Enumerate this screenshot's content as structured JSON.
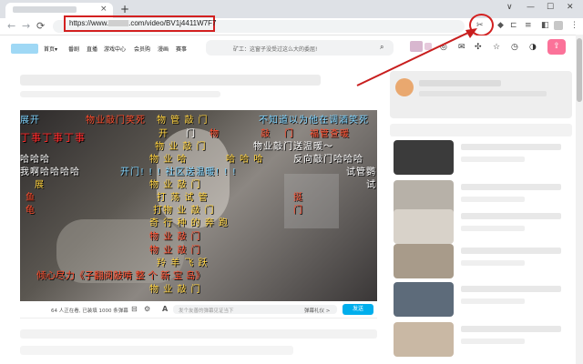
{
  "browser": {
    "newtab_icon": "+",
    "close_icon": "×",
    "window_controls": [
      "∨",
      "—",
      "☐",
      "✕"
    ],
    "nav_icons": [
      "←",
      "→",
      "⟳"
    ],
    "url_prefix": "https://www.",
    "url_suffix": ".com/video/BV1j4411W7F7"
  },
  "site": {
    "nav_items": [
      "首页",
      "番剧",
      "直播",
      "游戏中心",
      "会员购",
      "漫画",
      "赛事"
    ],
    "nav_chevron": "▾",
    "search_placeholder": "矿工：这窗子没受过这么大的委屈!",
    "search_icon": "⌕",
    "header_icons": [
      "◎",
      "✉",
      "☆",
      "◷",
      "◑"
    ],
    "upload_icon": "⇪"
  },
  "player": {
    "danmaku": [
      {
        "text": "展开",
        "color": "#7fd4ff"
      },
      {
        "text": "物业敲门笑死",
        "color": "#ff4b2b"
      },
      {
        "text": "物 管 敲 门",
        "color": "#ffd23f"
      },
      {
        "text": "不知道以为他在调酒笑死",
        "color": "#7fd4ff"
      },
      {
        "text": "开",
        "color": "#ffd23f"
      },
      {
        "text": "丁事丁事丁事",
        "color": "#ff2a2a"
      },
      {
        "text": "门",
        "color": "#ffffff"
      },
      {
        "text": "物",
        "color": "#ff4b2b"
      },
      {
        "text": "敲",
        "color": "#ff4b2b"
      },
      {
        "text": "门",
        "color": "#ff4b2b"
      },
      {
        "text": "福管查暖",
        "color": "#ff4b2b"
      },
      {
        "text": "物  业  敲  门",
        "color": "#ffd23f"
      },
      {
        "text": "物业敲门送温暖～",
        "color": "#ffffff"
      },
      {
        "text": "哈哈哈",
        "color": "#ffffff"
      },
      {
        "text": "物  业  哈",
        "color": "#ffd23f"
      },
      {
        "text": "哈  哈  哈",
        "color": "#ffd23f"
      },
      {
        "text": "反向敲门哈哈哈",
        "color": "#ffffff"
      },
      {
        "text": "我啊哈哈哈哈",
        "color": "#ffffff"
      },
      {
        "text": "开门! ! ! 社区送温暖! ! !",
        "color": "#7fd4ff"
      },
      {
        "text": "试管鹦",
        "color": "#ffffff"
      },
      {
        "text": "展",
        "color": "#ffd23f"
      },
      {
        "text": "物  业  敲  门",
        "color": "#ffd23f"
      },
      {
        "text": "试",
        "color": "#ffffff"
      },
      {
        "text": "鱼",
        "color": "#ff4b2b"
      },
      {
        "text": "打  荡  试  管",
        "color": "#ffd23f"
      },
      {
        "text": "挺",
        "color": "#ff4b2b"
      },
      {
        "text": "龟",
        "color": "#ff4b2b"
      },
      {
        "text": "打物  业  敲  门",
        "color": "#ffd23f"
      },
      {
        "text": "门",
        "color": "#ff4b2b"
      },
      {
        "text": "奇  行  种  的  奔  跑",
        "color": "#ffd23f"
      },
      {
        "text": "物    业    敲    门",
        "color": "#ff4b2b"
      },
      {
        "text": "物    业    敲    门",
        "color": "#ff4b2b"
      },
      {
        "text": "羚  羊  飞  跃",
        "color": "#ffd23f"
      },
      {
        "text": "倾心尽力《子翻阅敲啃  整  个  新  宝  岛》",
        "color": "#ff4b2b"
      },
      {
        "text": "物    业    敲    门",
        "color": "#ffd23f"
      }
    ],
    "controls": {
      "viewers_text": "64 人正在看, 已装填 1000 条弹幕",
      "danmaku_toggle_icon": "⊟",
      "settings_icon": "⚙",
      "font_icon": "A",
      "input_placeholder": "发个友善的弹幕见证当下",
      "etiquette_label": "弹幕礼仪 >",
      "send_label": "发送"
    }
  },
  "annotations": {
    "url_highlight_color": "#d32020",
    "arrow_color": "#c81e1e"
  }
}
